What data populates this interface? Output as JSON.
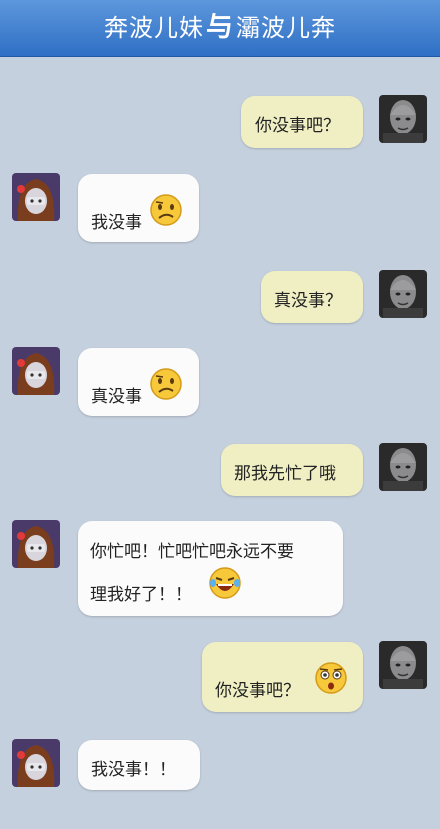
{
  "header": {
    "title_left": "奔波儿妹",
    "title_mid": "与",
    "title_right": "灞波儿奔"
  },
  "messages": [
    {
      "side": "right",
      "text": "你没事吧？"
    },
    {
      "side": "left",
      "text": "我没事",
      "emoji": "confused-face-icon"
    },
    {
      "side": "right",
      "text": "真没事？"
    },
    {
      "side": "left",
      "text": "真没事",
      "emoji": "confused-face-icon"
    },
    {
      "side": "right",
      "text": "那我先忙了哦"
    },
    {
      "side": "left",
      "line1": "你忙吧！忙吧忙吧永远不要",
      "line2": "理我好了！！",
      "emoji": "laughing-crying-face-icon"
    },
    {
      "side": "right",
      "text": "你没事吧？",
      "emoji": "shocked-face-icon"
    },
    {
      "side": "left",
      "text": "我没事！！"
    }
  ]
}
